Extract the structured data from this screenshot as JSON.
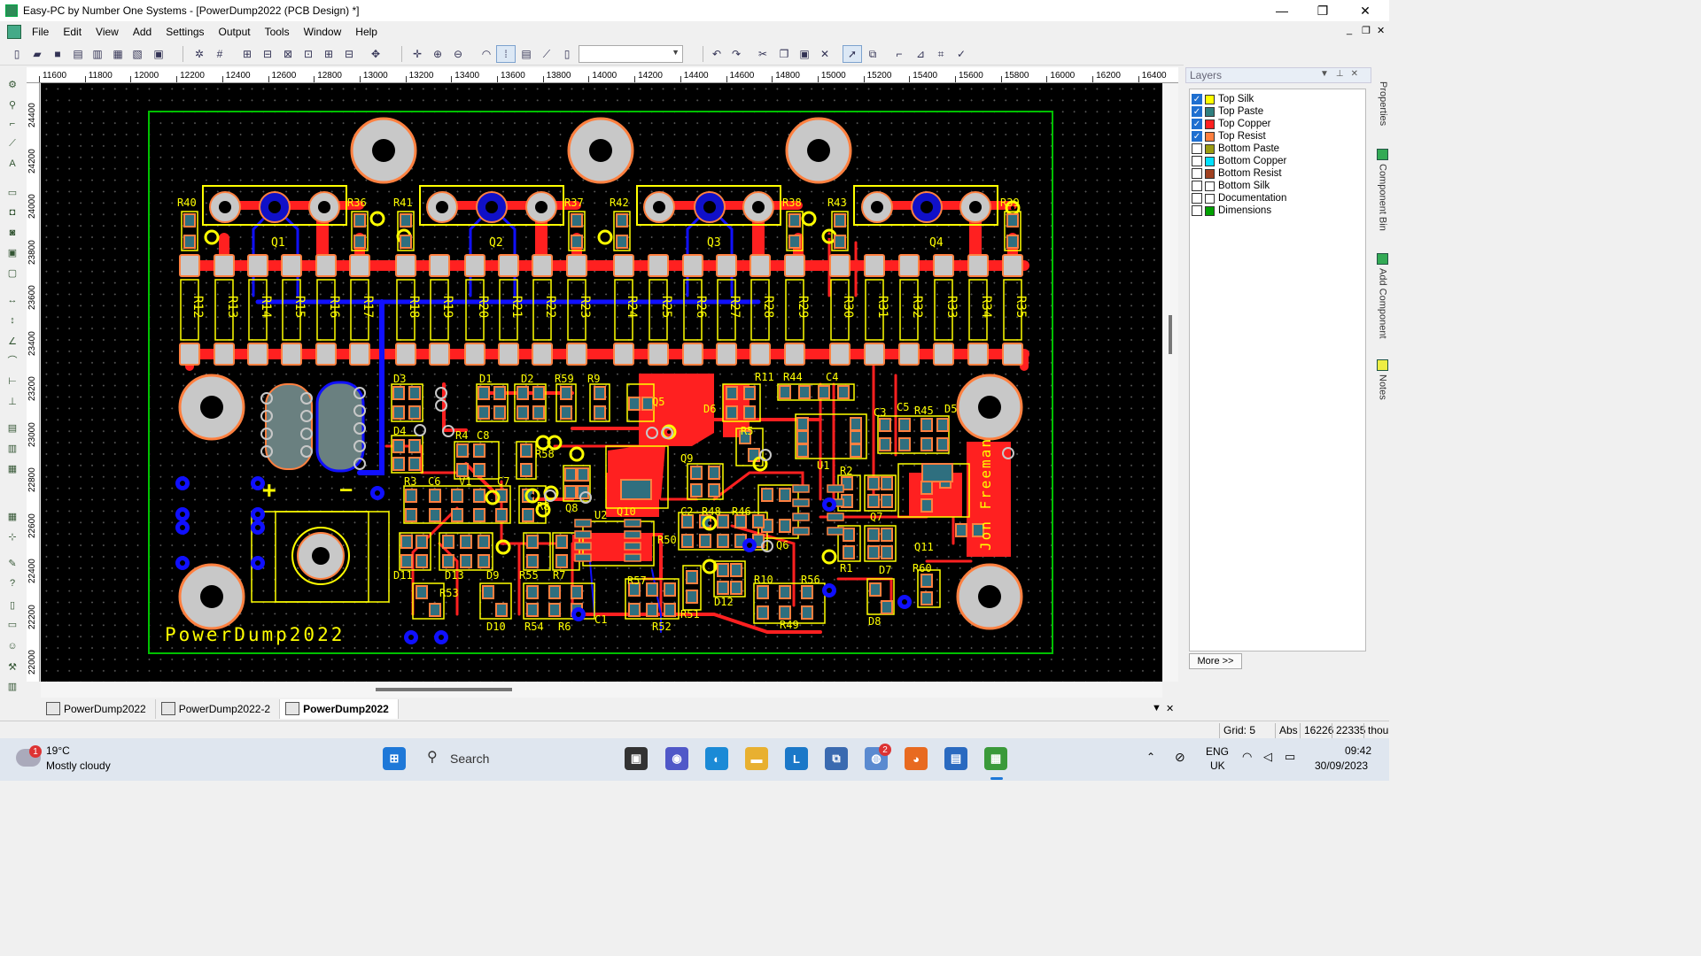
{
  "window": {
    "title": "Easy-PC by Number One Systems - [PowerDump2022 (PCB Design) *]",
    "minimize": "—",
    "maximize": "❐",
    "close": "✕"
  },
  "menu": {
    "items": [
      "File",
      "Edit",
      "View",
      "Add",
      "Settings",
      "Output",
      "Tools",
      "Window",
      "Help"
    ],
    "mdi_minimize": "_",
    "mdi_restore": "❐",
    "mdi_close": "✕"
  },
  "ruler": {
    "top": [
      "11600",
      "11800",
      "12000",
      "12200",
      "12400",
      "12600",
      "12800",
      "13000",
      "13200",
      "13400",
      "13600",
      "13800",
      "14000",
      "14200",
      "14400",
      "14600",
      "14800",
      "15000",
      "15200",
      "15400",
      "15600",
      "15800",
      "16000",
      "16200",
      "16400"
    ],
    "left": [
      "24400",
      "24200",
      "24000",
      "23800",
      "23600",
      "23400",
      "23200",
      "23000",
      "22800",
      "22600",
      "22400",
      "22200",
      "22000"
    ]
  },
  "pcb": {
    "board_label": "PowerDump2022",
    "author_label": "Jon Freeman",
    "plus_label": "+",
    "minus_label": "—",
    "transistors": [
      "Q1",
      "Q2",
      "Q3",
      "Q4"
    ],
    "transistor_resistors_left": [
      "R40",
      "R41",
      "R42",
      "R43"
    ],
    "transistor_resistors_right": [
      "R36",
      "R37",
      "R38",
      "R39"
    ],
    "resistor_bank": [
      "R12",
      "R13",
      "R14",
      "R15",
      "R16",
      "R17",
      "R18",
      "R19",
      "R20",
      "R21",
      "R22",
      "R23",
      "R24",
      "R25",
      "R26",
      "R27",
      "R28",
      "R29",
      "R30",
      "R31",
      "R32",
      "R33",
      "R34",
      "R35"
    ],
    "lower_labels": [
      {
        "id": "D3",
        "t": "D3"
      },
      {
        "id": "D1",
        "t": "D1"
      },
      {
        "id": "D2",
        "t": "D2"
      },
      {
        "id": "R59",
        "t": "R59"
      },
      {
        "id": "R9",
        "t": "R9"
      },
      {
        "id": "Q5",
        "t": "Q5"
      },
      {
        "id": "D6",
        "t": "D6"
      },
      {
        "id": "R11",
        "t": "R11"
      },
      {
        "id": "R44",
        "t": "R44"
      },
      {
        "id": "C4",
        "t": "C4"
      },
      {
        "id": "D4",
        "t": "D4"
      },
      {
        "id": "R4",
        "t": "R4"
      },
      {
        "id": "C8",
        "t": "C8"
      },
      {
        "id": "R58",
        "t": "R58"
      },
      {
        "id": "Q9",
        "t": "Q9"
      },
      {
        "id": "R5",
        "t": "R5"
      },
      {
        "id": "U1",
        "t": "U1"
      },
      {
        "id": "C3",
        "t": "C3"
      },
      {
        "id": "C5",
        "t": "C5"
      },
      {
        "id": "R45",
        "t": "R45"
      },
      {
        "id": "D5",
        "t": "D5"
      },
      {
        "id": "R2",
        "t": "R2"
      },
      {
        "id": "R3",
        "t": "R3"
      },
      {
        "id": "C6",
        "t": "C6"
      },
      {
        "id": "V1",
        "t": "V1"
      },
      {
        "id": "C7",
        "t": "C7"
      },
      {
        "id": "R8",
        "t": "R8"
      },
      {
        "id": "Q8",
        "t": "Q8"
      },
      {
        "id": "Q10",
        "t": "Q10"
      },
      {
        "id": "U2",
        "t": "U2"
      },
      {
        "id": "C2",
        "t": "C2"
      },
      {
        "id": "R48",
        "t": "R48"
      },
      {
        "id": "R46",
        "t": "R46"
      },
      {
        "id": "Q7",
        "t": "Q7"
      },
      {
        "id": "Q11",
        "t": "Q11"
      },
      {
        "id": "R50",
        "t": "R50"
      },
      {
        "id": "Q6",
        "t": "Q6"
      },
      {
        "id": "R1",
        "t": "R1"
      },
      {
        "id": "D7",
        "t": "D7"
      },
      {
        "id": "R60",
        "t": "R60"
      },
      {
        "id": "D11",
        "t": "D11"
      },
      {
        "id": "D13",
        "t": "D13"
      },
      {
        "id": "D9",
        "t": "D9"
      },
      {
        "id": "R55",
        "t": "R55"
      },
      {
        "id": "R7",
        "t": "R7"
      },
      {
        "id": "R57",
        "t": "R57"
      },
      {
        "id": "D12",
        "t": "D12"
      },
      {
        "id": "R10",
        "t": "R10"
      },
      {
        "id": "R56",
        "t": "R56"
      },
      {
        "id": "R53",
        "t": "R53"
      },
      {
        "id": "C1",
        "t": "C1"
      },
      {
        "id": "R51",
        "t": "R51"
      },
      {
        "id": "D8",
        "t": "D8"
      },
      {
        "id": "D10",
        "t": "D10"
      },
      {
        "id": "R54",
        "t": "R54"
      },
      {
        "id": "R6",
        "t": "R6"
      },
      {
        "id": "R52",
        "t": "R52"
      },
      {
        "id": "R49",
        "t": "R49"
      }
    ]
  },
  "layers": {
    "title": "Layers",
    "items": [
      {
        "name": "Top Silk",
        "checked": true,
        "color": "#ffff00"
      },
      {
        "name": "Top Paste",
        "checked": true,
        "color": "#2f7f7f"
      },
      {
        "name": "Top Copper",
        "checked": true,
        "color": "#ff2020"
      },
      {
        "name": "Top Resist",
        "checked": true,
        "color": "#ff8040"
      },
      {
        "name": "Bottom Paste",
        "checked": false,
        "color": "#9a9a10"
      },
      {
        "name": "Bottom Copper",
        "checked": false,
        "color": "#00e0ff"
      },
      {
        "name": "Bottom Resist",
        "checked": false,
        "color": "#a04020"
      },
      {
        "name": "Bottom Silk",
        "checked": false,
        "color": "#ffffff"
      },
      {
        "name": "Documentation",
        "checked": false,
        "color": "#ffffff"
      },
      {
        "name": "Dimensions",
        "checked": false,
        "color": "#00a000"
      }
    ],
    "more": "More >>"
  },
  "side_tabs": [
    "Properties",
    "Component Bin",
    "Add Component",
    "Notes"
  ],
  "tabs": [
    {
      "label": "PowerDump2022",
      "active": false
    },
    {
      "label": "PowerDump2022-2",
      "active": false
    },
    {
      "label": "PowerDump2022",
      "active": true
    }
  ],
  "status": {
    "grid": "Grid: 5",
    "mode": "Abs",
    "x": "16226",
    "y": "22335",
    "units": "thou"
  },
  "taskbar": {
    "weather_temp": "19°C",
    "weather_desc": "Mostly cloudy",
    "weather_badge": "1",
    "search": "Search",
    "chat_badge": "2",
    "lang": "ENG",
    "region": "UK",
    "time": "09:42",
    "date": "30/09/2023"
  },
  "colors": {
    "silk": "#ffff00",
    "copper": "#ff2020",
    "bottom_track": "#1010ff",
    "pad": "#c8c8c8",
    "pad_ring": "#ff8040",
    "outline": "#00c000"
  }
}
